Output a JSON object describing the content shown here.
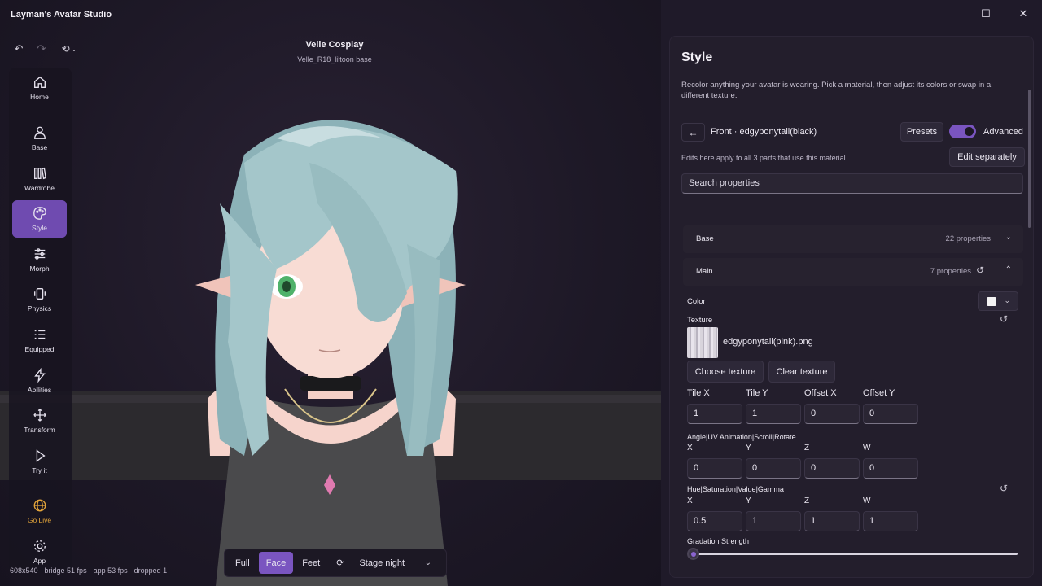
{
  "app": {
    "title": "Layman's Avatar Studio"
  },
  "history": {
    "undo": "↶",
    "redo": "↷",
    "history": "⟲"
  },
  "nav": {
    "items": [
      {
        "label": "Home"
      },
      {
        "label": "Base"
      },
      {
        "label": "Wardrobe"
      },
      {
        "label": "Style"
      },
      {
        "label": "Morph"
      },
      {
        "label": "Physics"
      },
      {
        "label": "Equipped"
      },
      {
        "label": "Abilities"
      },
      {
        "label": "Transform"
      },
      {
        "label": "Try it"
      },
      {
        "label": "Go Live"
      },
      {
        "label": "App"
      }
    ],
    "active": "Style",
    "golive_color": "#e2a43a",
    "accent": "#6f4bb0"
  },
  "viewport": {
    "model_title": "Velle Cosplay",
    "model_sub": "Velle_R18_liltoon base",
    "stats": "608x540 · bridge 51 fps · app 53 fps · dropped 1",
    "view_modes": [
      "Full",
      "Face",
      "Feet"
    ],
    "active_view": "Face",
    "stage": "Stage night"
  },
  "panel": {
    "title": "Style",
    "description": "Recolor anything your avatar is wearing. Pick a material, then adjust its colors or swap in a different texture.",
    "material": "Front · edgyponytail(black)",
    "presets": "Presets",
    "advanced": "Advanced",
    "advanced_on": true,
    "apply_note": "Edits here apply to all 3 parts that use this material.",
    "edit_separately": "Edit separately",
    "search_placeholder": "Search properties",
    "sections": [
      {
        "name": "Base",
        "count": "22 properties"
      },
      {
        "name": "Main",
        "count": "7 properties"
      }
    ],
    "color_label": "Color",
    "texture_label": "Texture",
    "texture_file": "edgyponytail(pink).png",
    "choose_texture": "Choose texture",
    "clear_texture": "Clear texture",
    "tile_offset": {
      "labels": [
        "Tile X",
        "Tile Y",
        "Offset X",
        "Offset Y"
      ],
      "values": [
        "1",
        "1",
        "0",
        "0"
      ]
    },
    "angle_uv": {
      "label": "Angle|UV Animation|Scroll|Rotate",
      "axes": [
        "X",
        "Y",
        "Z",
        "W"
      ],
      "values": [
        "0",
        "0",
        "0",
        "0"
      ]
    },
    "hsvg": {
      "label": "Hue|Saturation|Value|Gamma",
      "axes": [
        "X",
        "Y",
        "Z",
        "W"
      ],
      "values": [
        "0.5",
        "1",
        "1",
        "1"
      ]
    },
    "gradation_label": "Gradation Strength",
    "gradation_value": 0
  }
}
